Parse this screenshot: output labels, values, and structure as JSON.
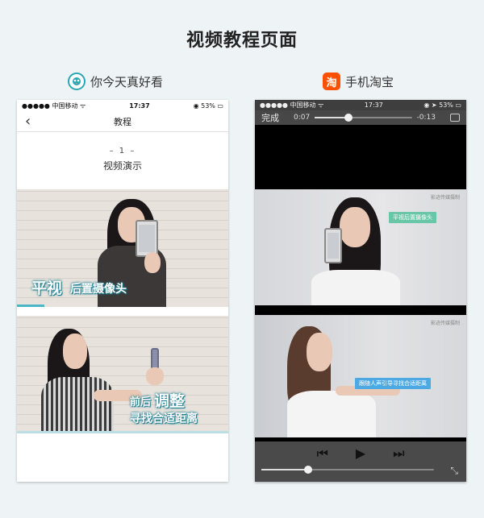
{
  "page": {
    "title": "视频教程页面"
  },
  "left_app": {
    "name": "你今天真好看",
    "status": {
      "carrier": "●●●●● 中国移动 ᯤ",
      "time": "17:37",
      "battery": "◉ 53% ▭"
    },
    "nav_title": "教程",
    "step_number": "– 1 –",
    "step_title": "视频演示",
    "frame1_caption_big": "平视",
    "frame1_caption_small": "后置摄像头",
    "frame2_caption_line1_small": "前后",
    "frame2_caption_line1_big": "调整",
    "frame2_caption_line2": "寻找合适距离"
  },
  "right_app": {
    "name": "手机淘宝",
    "icon_char": "淘",
    "status": {
      "carrier": "●●●●● 中国移动 ᯤ",
      "time": "17:37",
      "battery": "◉ ➤ 53% ▭"
    },
    "done_label": "完成",
    "elapsed": "0:07",
    "remaining": "-0:13",
    "watermark": "影迹传媒摄制",
    "tag1": "平视后置摄像头",
    "tag2": "跟随人声引导寻找合适距离",
    "prev_icon": "⏮",
    "play_icon": "▶",
    "next_icon": "⏭",
    "exit_icon": "⤡",
    "progress": 0.35,
    "bottom_progress": 0.27
  },
  "colors": {
    "accent_teal": "#4ab6c6",
    "taobao_orange": "#ff5000"
  }
}
